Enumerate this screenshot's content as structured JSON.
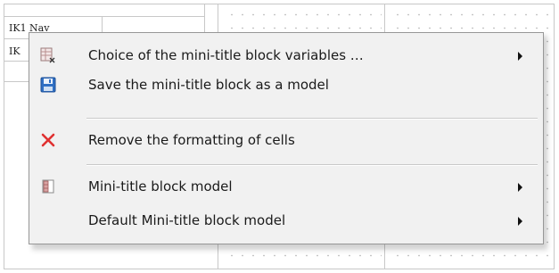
{
  "background": {
    "cell_text_1": "IK1 Nav",
    "cell_text_2": "IK"
  },
  "menu": {
    "items": [
      {
        "label": "Choice of the mini-title block variables …",
        "icon": "table-variables-icon",
        "submenu": true
      },
      {
        "label": "Save the mini-title block as a model",
        "icon": "floppy-disk-icon",
        "submenu": false
      },
      {
        "label": "Remove the formatting of cells",
        "icon": "red-x-icon",
        "submenu": false
      },
      {
        "label": "Mini-title block model",
        "icon": "title-block-model-icon",
        "submenu": true
      },
      {
        "label": "Default Mini-title block model",
        "icon": "",
        "submenu": true
      }
    ]
  },
  "colors": {
    "menu_background": "#f1f1f1",
    "menu_border": "#979797",
    "remove_icon_red": "#e03131",
    "save_icon_blue": "#2f6fc4"
  }
}
